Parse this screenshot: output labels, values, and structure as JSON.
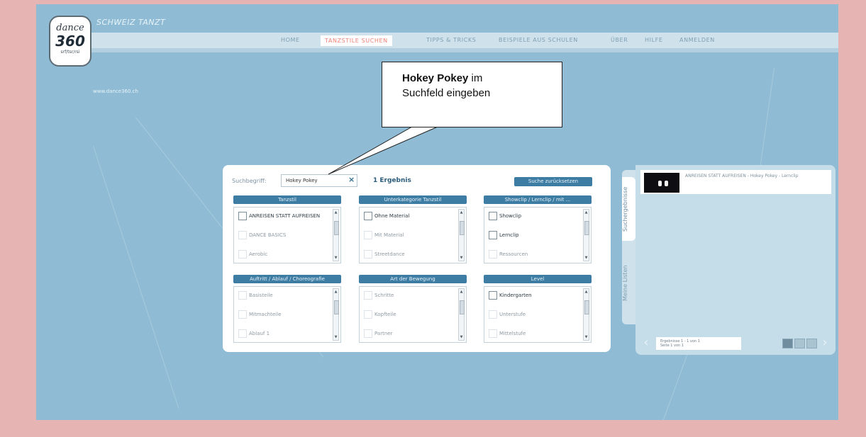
{
  "app": {
    "logo_top": "dance",
    "logo_main": "360",
    "logo_bottom": "srf/tsr/rsi",
    "brand_tagline": "SCHWEIZ TANZT",
    "site_url": "www.dance360.ch"
  },
  "nav": {
    "items": [
      {
        "label": "HOME",
        "active": false
      },
      {
        "label": "TANZSTILE SUCHEN",
        "active": true
      },
      {
        "label": "TIPPS & TRICKS",
        "active": false
      },
      {
        "label": "BEISPIELE AUS SCHULEN",
        "active": false
      },
      {
        "label": "ÜBER",
        "active": false
      },
      {
        "label": "HILFE",
        "active": false
      },
      {
        "label": "ANMELDEN",
        "active": false
      }
    ]
  },
  "callout": {
    "bold": "Hokey Pokey",
    "rest1": " im",
    "rest2": "Suchfeld eingeben"
  },
  "search": {
    "label": "Suchbegriff:",
    "value": "Hokey Pokey",
    "clear_icon": "×",
    "results_count": "1 Ergebnis",
    "reset_label": "Suche zurücksetzen"
  },
  "filters": [
    {
      "header": "Tanzstil",
      "options": [
        {
          "label": "ANREISEN STATT AUFREISEN",
          "state": "on"
        },
        {
          "label": "DANCE BASICS",
          "state": "dim"
        },
        {
          "label": "Aerobic",
          "state": "dim"
        }
      ]
    },
    {
      "header": "Unterkategorie Tanzstil",
      "options": [
        {
          "label": "Ohne Material",
          "state": "on"
        },
        {
          "label": "Mit Material",
          "state": "dim"
        },
        {
          "label": "Streetdance",
          "state": "dim"
        }
      ]
    },
    {
      "header": "Showclip / Lernclip / mit ...",
      "options": [
        {
          "label": "Showclip",
          "state": "on"
        },
        {
          "label": "Lernclip",
          "state": "on"
        },
        {
          "label": "Ressourcen",
          "state": "dim"
        }
      ]
    },
    {
      "header": "Auftritt / Ablauf / Choreografie",
      "options": [
        {
          "label": "Basisteile",
          "state": "dim"
        },
        {
          "label": "Mitmachteile",
          "state": "dim"
        },
        {
          "label": "Ablauf 1",
          "state": "dim"
        }
      ]
    },
    {
      "header": "Art der Bewegung",
      "options": [
        {
          "label": "Schritte",
          "state": "dim"
        },
        {
          "label": "Kopfteile",
          "state": "dim"
        },
        {
          "label": "Partner",
          "state": "dim"
        }
      ]
    },
    {
      "header": "Level",
      "options": [
        {
          "label": "Kindergarten",
          "state": "on"
        },
        {
          "label": "Unterstufe",
          "state": "dim"
        },
        {
          "label": "Mittelstufe",
          "state": "dim"
        }
      ]
    }
  ],
  "side_tabs": {
    "results": "Suchergebnisse",
    "lists": "Meine Listen"
  },
  "result": {
    "title": "ANREISEN STATT AUFREISEN - Hokey Pokey - Lernclip"
  },
  "pager": {
    "line1": "Ergebnisse 1 - 1 von 1",
    "line2": "Seite 1 von 1",
    "prev": "‹",
    "next": "›"
  },
  "colors": {
    "accent": "#3d7ca3",
    "background": "#8fbcd4",
    "active_nav": "#ee7f74",
    "frame": "#e6b5b3"
  }
}
